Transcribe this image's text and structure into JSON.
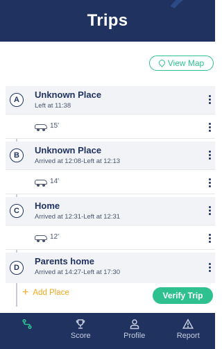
{
  "header": {
    "title": "Trips"
  },
  "main": {
    "view_map_label": "View Map",
    "places": [
      {
        "marker": "A",
        "name": "Unknown Place",
        "time": "Left at 11:38"
      },
      {
        "marker": "B",
        "name": "Unknown Place",
        "time": "Arrived at 12:08-Left at 12:13"
      },
      {
        "marker": "C",
        "name": "Home",
        "time": "Arrived at 12:31-Left at 12:31"
      },
      {
        "marker": "D",
        "name": "Parents home",
        "time": "Arrived at 14:27-Left at 17:30"
      }
    ],
    "travel": [
      {
        "duration": "15'",
        "icon": "car-icon"
      },
      {
        "duration": "14'",
        "icon": "car-icon"
      },
      {
        "duration": "12'",
        "icon": "car-icon"
      }
    ],
    "add_place_label": "Add Place",
    "verify_trip_label": "Verify Trip"
  },
  "nav": {
    "items": [
      {
        "label": "",
        "icon": "route-icon"
      },
      {
        "label": "Score",
        "icon": "trophy-icon"
      },
      {
        "label": "Profile",
        "icon": "profile-icon"
      },
      {
        "label": "Report",
        "icon": "warning-icon"
      }
    ]
  },
  "colors": {
    "primary": "#1f3260",
    "accent_green": "#2ec08f",
    "accent_orange": "#f3a81f"
  }
}
